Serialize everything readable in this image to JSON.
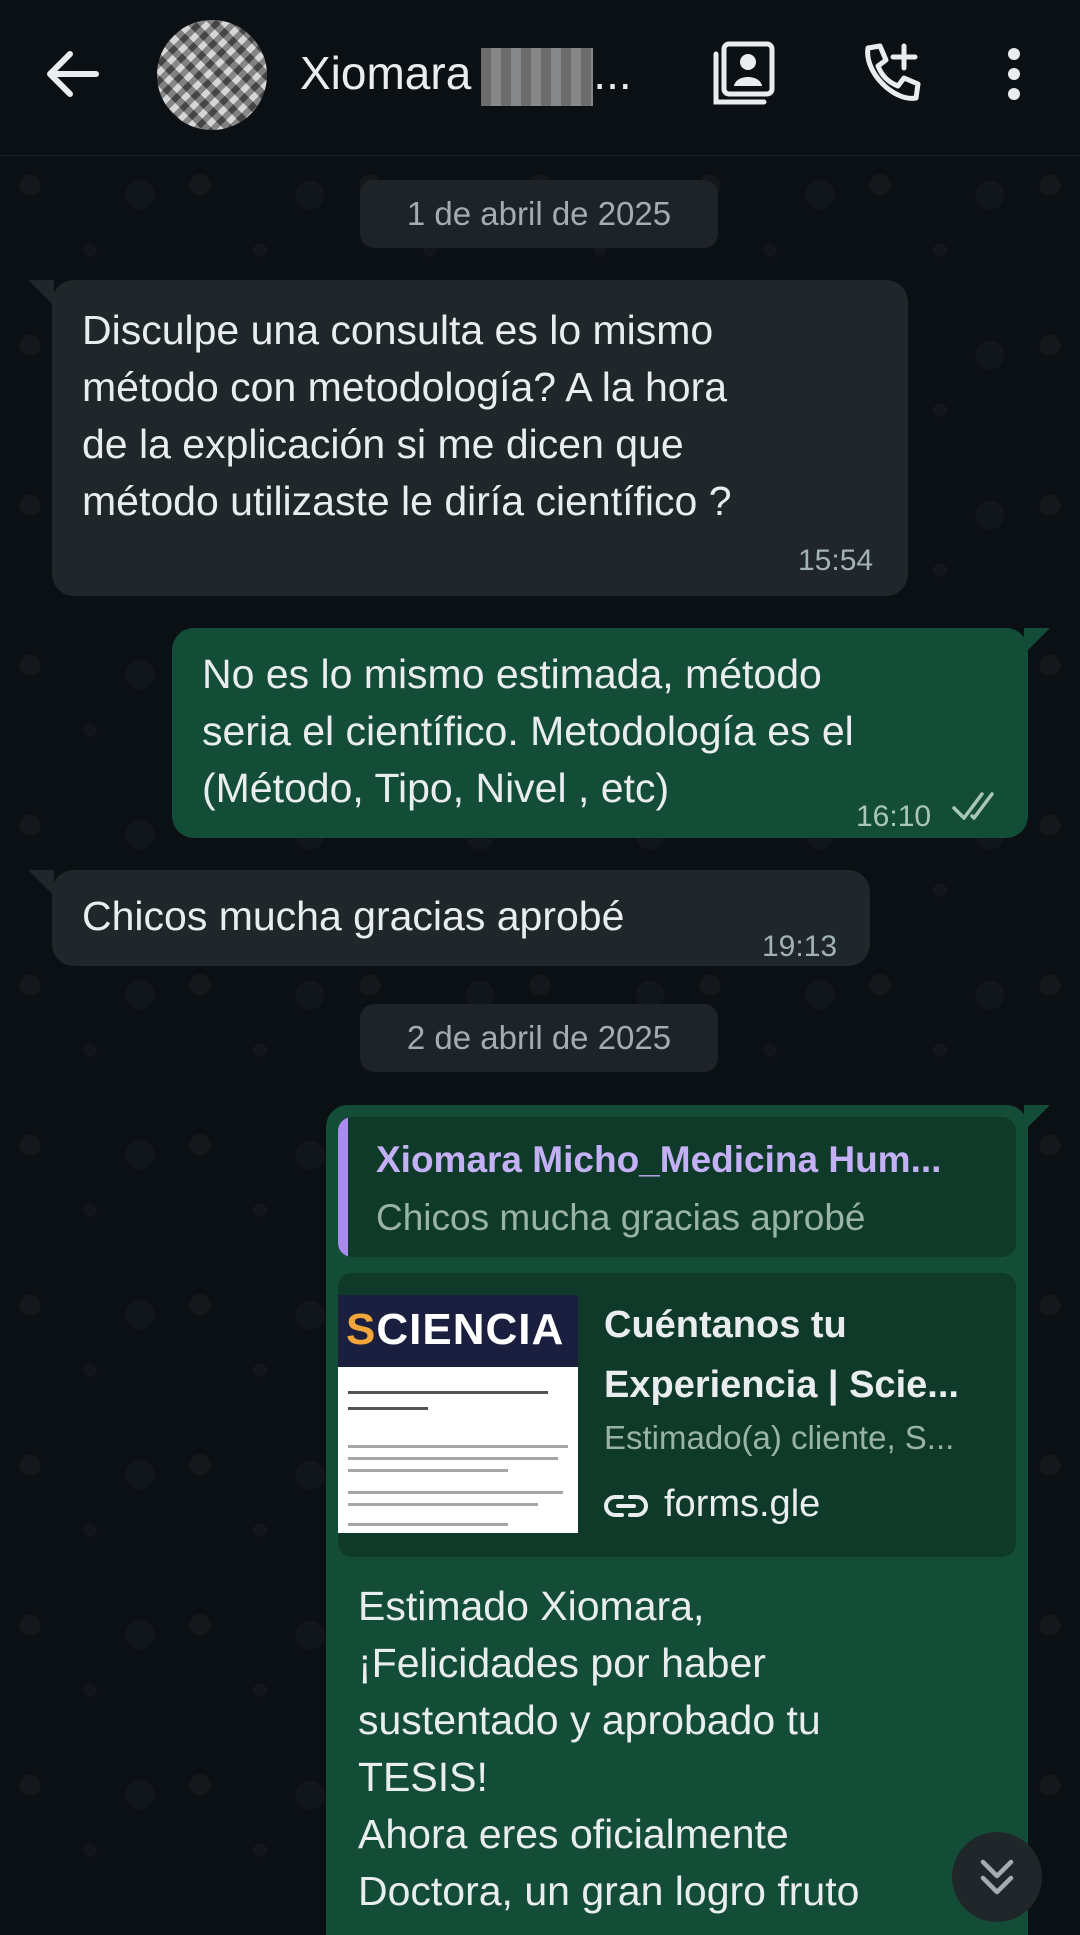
{
  "header": {
    "contact_name": "Xiomara",
    "ellipsis": "..."
  },
  "chat": {
    "date1": "1 de abril de 2025",
    "msg1": {
      "lines": [
        "Disculpe una consulta es lo mismo",
        "método con metodología? A la hora",
        "de la explicación si me dicen que",
        "método utilizaste le diría científico ?"
      ],
      "time": "15:54"
    },
    "msg2": {
      "lines": [
        "No es lo mismo estimada, método",
        "seria el científico. Metodología es el",
        "(Método, Tipo, Nivel , etc)"
      ],
      "time": "16:10"
    },
    "msg3": {
      "text": "Chicos mucha gracias aprobé",
      "time": "19:13"
    },
    "date2": "2 de abril de 2025",
    "msg4": {
      "quote_author": "Xiomara Micho_Medicina Hum...",
      "quote_text": "Chicos mucha gracias aprobé",
      "preview": {
        "thumb_brand_s": "S",
        "thumb_brand_rest": "CIENCIA",
        "title_line1": "Cuéntanos tu",
        "title_line2": "Experiencia | Scie...",
        "description": "Estimado(a) cliente, S...",
        "link": "forms.gle"
      },
      "lines": [
        "Estimado Xiomara,",
        "¡Felicidades por haber",
        "sustentado y aprobado tu",
        "TESIS!",
        "Ahora eres oficialmente",
        "Doctora, un gran logro fruto"
      ]
    }
  }
}
